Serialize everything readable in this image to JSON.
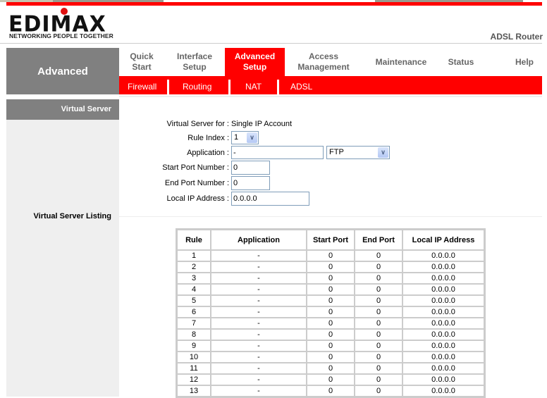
{
  "header": {
    "logo_text": "EDIMAX",
    "logo_tagline": "NETWORKING PEOPLE TOGETHER",
    "product_name": "ADSL Router"
  },
  "section_label": "Advanced",
  "nav": {
    "tabs": [
      {
        "label": "Quick Start",
        "active": false
      },
      {
        "label": "Interface Setup",
        "active": false
      },
      {
        "label": "Advanced Setup",
        "active": true
      },
      {
        "label": "Access Management",
        "active": false
      },
      {
        "label": "Maintenance",
        "active": false
      },
      {
        "label": "Status",
        "active": false
      },
      {
        "label": "Help",
        "active": false
      }
    ],
    "subtabs": [
      "Firewall",
      "Routing",
      "NAT",
      "ADSL"
    ]
  },
  "colors": {
    "accent": "#ff0000",
    "sidebar": "#808080",
    "panel": "#efefef"
  },
  "virtual_server": {
    "title": "Virtual Server",
    "for_label": "Virtual Server for :",
    "for_value": "Single IP Account",
    "rule_index_label": "Rule Index :",
    "rule_index_value": "1",
    "application_label": "Application :",
    "application_value": "-",
    "application_select": "FTP",
    "start_port_label": "Start Port Number :",
    "start_port_value": "0",
    "end_port_label": "End Port Number :",
    "end_port_value": "0",
    "local_ip_label": "Local IP Address :",
    "local_ip_value": "0.0.0.0"
  },
  "listing": {
    "title": "Virtual Server Listing",
    "columns": [
      "Rule",
      "Application",
      "Start Port",
      "End Port",
      "Local IP Address"
    ],
    "rows": [
      [
        "1",
        "-",
        "0",
        "0",
        "0.0.0.0"
      ],
      [
        "2",
        "-",
        "0",
        "0",
        "0.0.0.0"
      ],
      [
        "3",
        "-",
        "0",
        "0",
        "0.0.0.0"
      ],
      [
        "4",
        "-",
        "0",
        "0",
        "0.0.0.0"
      ],
      [
        "5",
        "-",
        "0",
        "0",
        "0.0.0.0"
      ],
      [
        "6",
        "-",
        "0",
        "0",
        "0.0.0.0"
      ],
      [
        "7",
        "-",
        "0",
        "0",
        "0.0.0.0"
      ],
      [
        "8",
        "-",
        "0",
        "0",
        "0.0.0.0"
      ],
      [
        "9",
        "-",
        "0",
        "0",
        "0.0.0.0"
      ],
      [
        "10",
        "-",
        "0",
        "0",
        "0.0.0.0"
      ],
      [
        "11",
        "-",
        "0",
        "0",
        "0.0.0.0"
      ],
      [
        "12",
        "-",
        "0",
        "0",
        "0.0.0.0"
      ],
      [
        "13",
        "-",
        "0",
        "0",
        "0.0.0.0"
      ]
    ]
  }
}
